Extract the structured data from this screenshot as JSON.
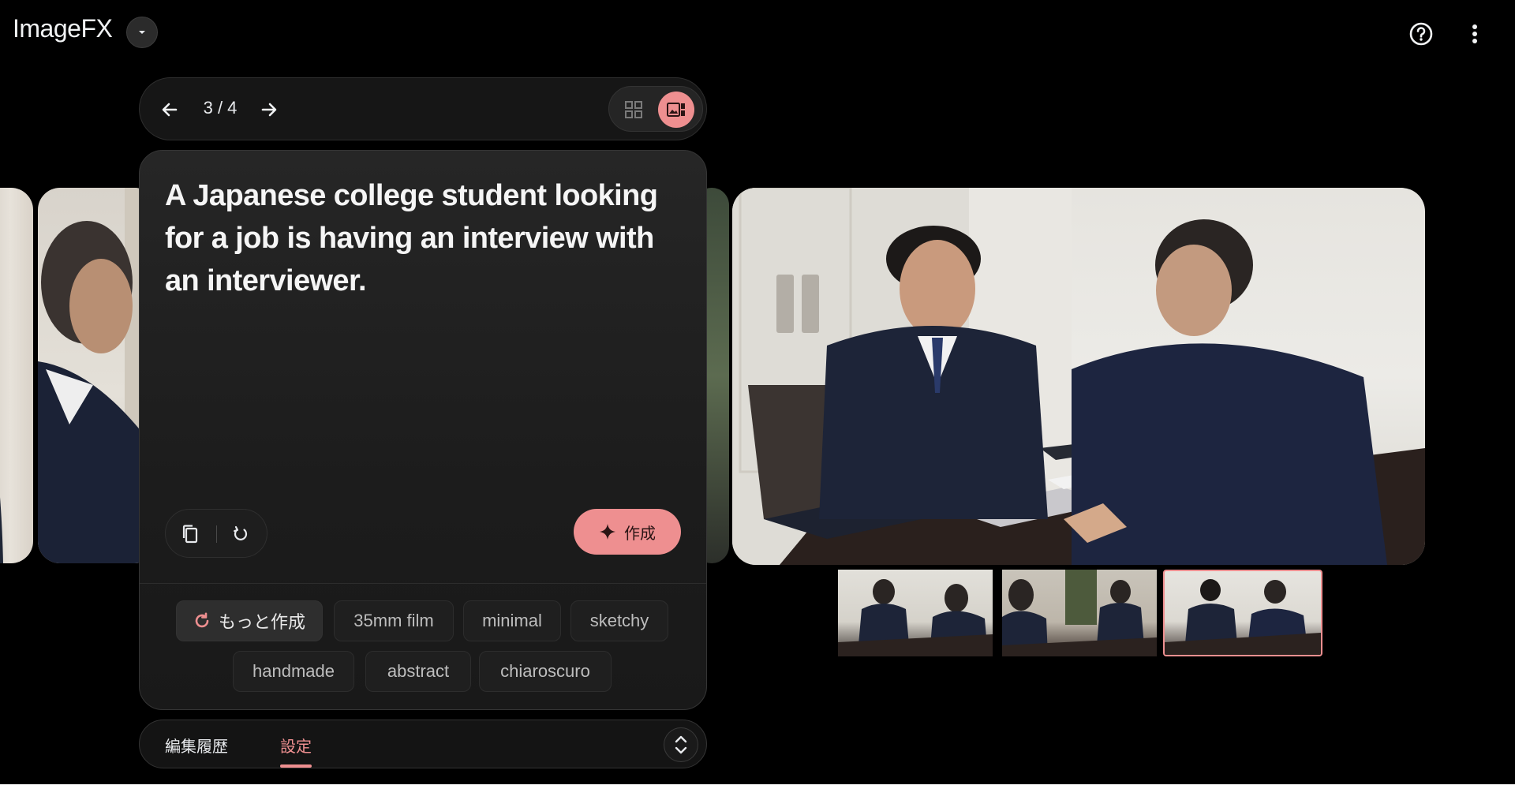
{
  "header": {
    "app_title": "ImageFX",
    "dropdown_icon": "chevron-down-icon",
    "help_icon": "help-circle-icon",
    "more_icon": "more-vert-icon"
  },
  "navigator": {
    "counter": "3 / 4",
    "prev_icon": "arrow-left-icon",
    "next_icon": "arrow-right-icon",
    "views": [
      {
        "name": "grid",
        "icon": "grid-icon",
        "active": false
      },
      {
        "name": "single",
        "icon": "single-image-icon",
        "active": true
      }
    ]
  },
  "prompt_card": {
    "prompt": "A Japanese college student looking for a job is having an interview with an interviewer.",
    "copy_icon": "copy-icon",
    "reset_icon": "reset-icon",
    "create_label": "作成",
    "create_icon": "sparkle-icon",
    "suggestions": {
      "more": {
        "label": "もっと作成",
        "icon": "refresh-icon"
      },
      "chips": [
        "35mm film",
        "minimal",
        "sketchy",
        "handmade",
        "abstract",
        "chiaroscuro"
      ]
    }
  },
  "bottom_tabs": {
    "tabs": [
      {
        "label": "編集履歴",
        "active": false
      },
      {
        "label": "設定",
        "active": true
      }
    ],
    "expand_icon": "unfold-icon"
  },
  "gallery": {
    "selected_index": 3,
    "total": 4,
    "thumbnail_count": 3
  },
  "colors": {
    "accent": "#ee8f90",
    "background": "#000000",
    "card": "#1f1f1f"
  }
}
